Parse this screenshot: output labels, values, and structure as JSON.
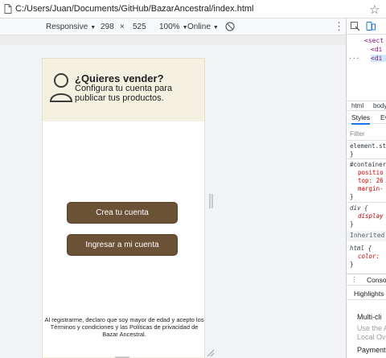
{
  "address_bar": {
    "url": "C:/Users/Juan/Documents/GitHub/BazarAncestral/index.html",
    "icons": [
      "file-icon",
      "bookmark-star-icon"
    ]
  },
  "device_toolbar": {
    "device": "Responsive",
    "width": "298",
    "times": "×",
    "height": "525",
    "zoom": "100%",
    "throttle": "Online",
    "icons": [
      "rotate-icon",
      "more-options-icon"
    ]
  },
  "page": {
    "banner": {
      "title": "¿Quieres vender?",
      "subtitle": "Configura tu cuenta para publicar tus productos.",
      "icon": "user-icon"
    },
    "create_account_label": "Crea tu cuenta",
    "login_label": "Ingresar a mi cuenta",
    "disclaimer": "Al registrarme, declaro que soy mayor de edad y acepto los Términos y condiciones y las Políticas de privacidad de Bazar Ancestral.",
    "colors": {
      "banner_bg": "#f5f1e0",
      "button_bg": "#6b5135"
    }
  },
  "devtools": {
    "dom_lines": [
      "<sect",
      "<di",
      "<di"
    ],
    "breadcrumbs": [
      "html",
      "body"
    ],
    "tabs": [
      "Styles",
      "Ev"
    ],
    "filter_placeholder": "Filter",
    "rules": {
      "element_style": "element.st",
      "brace_close": "}",
      "container_selector": "#container",
      "prop_position": "positio",
      "prop_top": "top: 26",
      "prop_margin": "margin-",
      "div_selector": "div {",
      "prop_display": "display",
      "inherited_label": "Inherited fro",
      "html_selector": "html {",
      "prop_color": "color:"
    },
    "console_label": "Conso",
    "highlights_label": "Highlights",
    "highlights": {
      "item1_title": "Multi-cli",
      "item1_line1": "Use the A",
      "item1_line2": "Local Ove",
      "item2_title": "Payment"
    },
    "icons": [
      "inspect-icon",
      "device-toggle-icon"
    ]
  }
}
